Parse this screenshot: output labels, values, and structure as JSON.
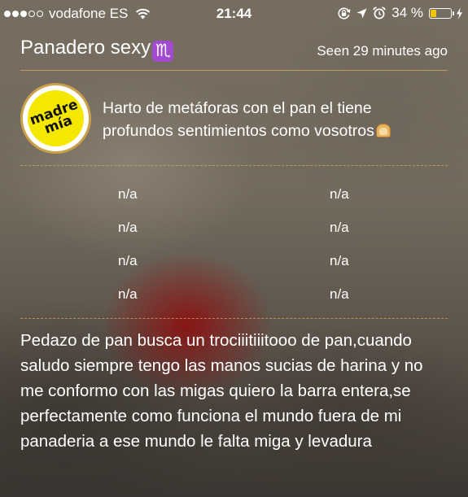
{
  "status_bar": {
    "carrier": "vodafone ES",
    "time": "21:44",
    "battery_percent": "34 %",
    "battery_level": 0.34,
    "signal_filled": 3,
    "signal_total": 5,
    "icons": [
      "signal-dots-icon",
      "wifi-icon",
      "rotation-lock-icon",
      "location-arrow-icon",
      "alarm-clock-icon",
      "battery-icon",
      "charging-bolt-icon"
    ],
    "colors": {
      "battery_fill": "#f5c400"
    }
  },
  "header": {
    "name": "Panadero sexy",
    "zodiac_symbol": "♏",
    "seen_status": "Seen 29 minutes ago",
    "colors": {
      "zodiac_badge": "#a24bd0",
      "divider": "#d7af64"
    }
  },
  "bio": {
    "avatar_text": [
      "madre",
      "mía"
    ],
    "avatar_colors": {
      "ring": "#caa04a",
      "fill": "#f5e800"
    },
    "text": "Harto de metáforas con el  pan  el tiene\nprofundos sentimientos como vosotros",
    "trailing_icon": "bread-icon"
  },
  "info_grid": [
    [
      "n/a",
      "n/a"
    ],
    [
      "n/a",
      "n/a"
    ],
    [
      "n/a",
      "n/a"
    ],
    [
      "n/a",
      "n/a"
    ]
  ],
  "description": "Pedazo de pan busca un trociiitiiitooo de pan,cuando\nsaludo siempre tengo las manos sucias de harina y no\nme conformo con las migas quiero la barra entera,se\nperfectamente como funciona el mundo  fuera de mi\npanaderia  a ese mundo le falta miga y levadura"
}
